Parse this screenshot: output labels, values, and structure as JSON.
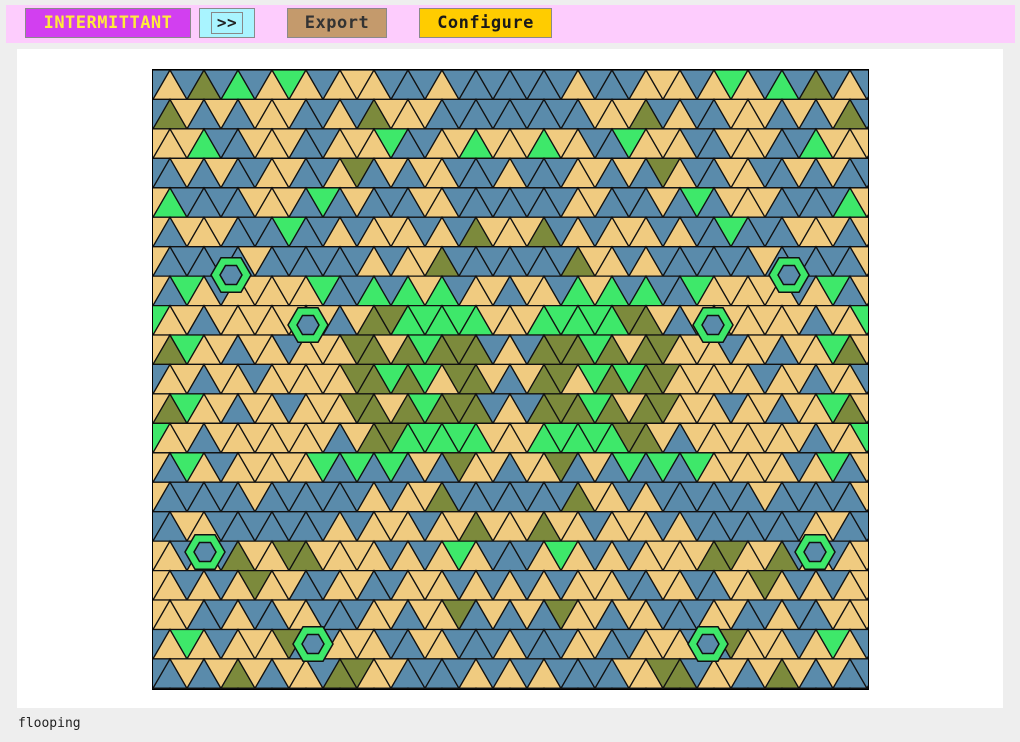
{
  "toolbar": {
    "mode_label": "INTERMITTANT",
    "next_label": ">>",
    "export_label": "Export",
    "configure_label": "Configure"
  },
  "canvas": {
    "name": "kaleidoscope-tiling",
    "palette": {
      "blue": "#5a8bab",
      "tan": "#f0cb80",
      "olive": "#7c8a3c",
      "green": "#3ee86a",
      "stroke": "#111111"
    }
  },
  "status": {
    "text": "flooping"
  },
  "colors": {
    "toolbar_bg": "#fdccfd",
    "mode_button": "#d23ff0",
    "mode_text": "#ffeb3b",
    "next_button": "#a9f4ff",
    "export_button": "#c49a6c",
    "configure_button": "#ffcc00",
    "page_bg": "#eeeeee",
    "panel_bg": "#ffffff"
  }
}
